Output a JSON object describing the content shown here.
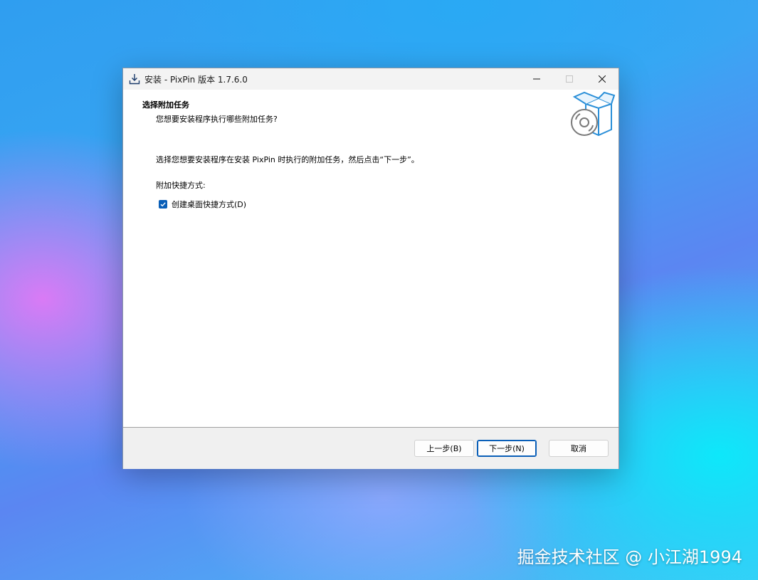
{
  "window": {
    "title": "安装 - PixPin 版本 1.7.6.0",
    "controls": {
      "minimize": "—",
      "maximize": "☐",
      "close": "✕"
    }
  },
  "header": {
    "title": "选择附加任务",
    "subtitle": "您想要安装程序执行哪些附加任务?",
    "icon": "box-disc-icon"
  },
  "body": {
    "description": "选择您想要安装程序在安装 PixPin 时执行的附加任务，然后点击“下一步”。",
    "group_label": "附加快捷方式:",
    "checkbox": {
      "label": "创建桌面快捷方式(D)",
      "checked": true
    }
  },
  "buttons": {
    "back": "上一步(B)",
    "next": "下一步(N)",
    "cancel": "取消"
  },
  "watermark": "掘金技术社区 @ 小江湖1994",
  "colors": {
    "accent": "#0a5fb8",
    "titlebar": "#f3f3f3",
    "footer": "#f0f0f0"
  }
}
